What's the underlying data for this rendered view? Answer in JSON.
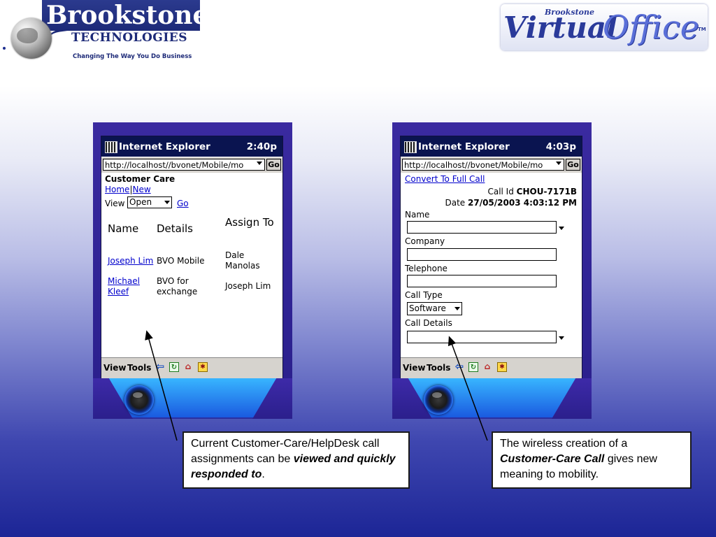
{
  "logos": {
    "brookstone_name": "Brookstone",
    "brookstone_tech": "TECHNOLOGIES",
    "brookstone_tagline": "Changing The Way You Do Business",
    "virtual_office_small": "Brookstone",
    "virtual_office_virtual": "Virtual",
    "virtual_office_office": "Office",
    "virtual_office_tm": "TM"
  },
  "pda_left": {
    "app_title": "Internet Explorer",
    "time": "2:40p",
    "url": "http://localhost//bvonet/Mobile/mo",
    "go_button": "Go",
    "heading": "Customer Care",
    "nav_home": "Home",
    "nav_sep": "|",
    "nav_new": "New",
    "view_label": "View",
    "view_select": "Open",
    "view_go": "Go",
    "table": {
      "headers": [
        "Name",
        "Details",
        "Assign To"
      ],
      "rows": [
        {
          "name": "Joseph Lim",
          "details": "BVO Mobile",
          "assign": "Dale Manolas"
        },
        {
          "name": "Michael Kleef",
          "details": "BVO for exchange",
          "assign": "Joseph Lim"
        }
      ]
    },
    "toolbar": {
      "view": "View",
      "tools": "Tools"
    }
  },
  "pda_right": {
    "app_title": "Internet Explorer",
    "time": "4:03p",
    "url": "http://localhost//bvonet/Mobile/mo",
    "go_button": "Go",
    "convert_link": "Convert To Full Call",
    "call_id_label": "Call Id",
    "call_id_value": "CHOU-7171B",
    "date_label": "Date",
    "date_value": "27/05/2003 4:03:12 PM",
    "name_label": "Name",
    "company_label": "Company",
    "telephone_label": "Telephone",
    "call_type_label": "Call Type",
    "call_type_value": "Software",
    "call_details_label": "Call Details",
    "toolbar": {
      "view": "View",
      "tools": "Tools"
    }
  },
  "callouts": {
    "left": {
      "text1": "Current Customer-Care/HelpDesk call assignments can be ",
      "emph": "viewed and quickly responded to",
      "text2": "."
    },
    "right": {
      "text1": "The wireless creation of a ",
      "emph": "Customer-Care Call",
      "text2": " gives new meaning to mobility."
    }
  },
  "colors": {
    "titlebar": "#0a1450",
    "link": "#0000cc",
    "device_body": "#2f2394",
    "brand_blue": "#1d2a78"
  }
}
